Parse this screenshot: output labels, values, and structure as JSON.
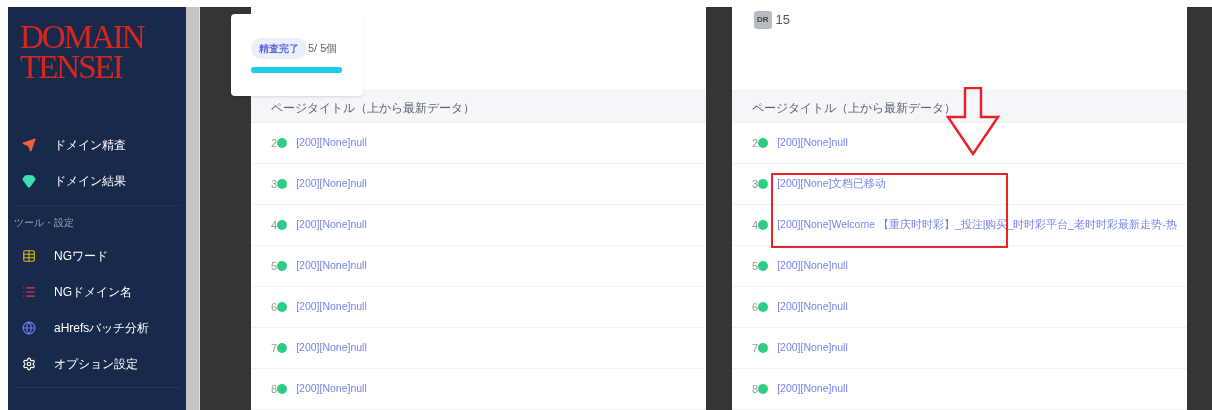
{
  "sidebar": {
    "logo": [
      "DOMAIN",
      "TENSEI"
    ],
    "items": [
      {
        "kind": "send",
        "label": "ドメイン精査"
      },
      {
        "kind": "gem",
        "label": "ドメイン結果"
      }
    ],
    "section": "ツール・設定",
    "tools": [
      {
        "kind": "table",
        "label": "NGワード"
      },
      {
        "kind": "list",
        "label": "NGドメイン名"
      },
      {
        "kind": "planet",
        "label": "aHrefsバッチ分析"
      },
      {
        "kind": "gear",
        "label": "オプション設定"
      }
    ]
  },
  "progress_popup": {
    "badge": "精査完了",
    "count": "5/ 5個",
    "level": 1
  },
  "panels": [
    {
      "header": "ページタイトル（上から最新データ）",
      "rows": [
        {
          "number": "2",
          "title": "[200][None]null"
        },
        {
          "number": "3",
          "title": "[200][None]null"
        },
        {
          "number": "4",
          "title": "[200][None]null"
        },
        {
          "number": "5",
          "title": "[200][None]null"
        },
        {
          "number": "6",
          "title": "[200][None]null"
        },
        {
          "number": "7",
          "title": "[200][None]null"
        },
        {
          "number": "8",
          "title": "[200][None]null"
        }
      ]
    },
    {
      "dr_badge": "DR",
      "dr_value": "15",
      "header": "ページタイトル（上から最新データ）",
      "rows": [
        {
          "number": "2",
          "title": "[200][None]null"
        },
        {
          "number": "3",
          "title": "[200][None]文档已移动"
        },
        {
          "number": "4",
          "title": "[200][None]Welcome 【重庆时时彩】_投注|购买_时时彩平台_老时时彩最新走势-热"
        },
        {
          "number": "5",
          "title": "[200][None]null"
        },
        {
          "number": "6",
          "title": "[200][None]null"
        },
        {
          "number": "7",
          "title": "[200][None]null"
        },
        {
          "number": "8",
          "title": "[200][None]null"
        }
      ]
    }
  ]
}
